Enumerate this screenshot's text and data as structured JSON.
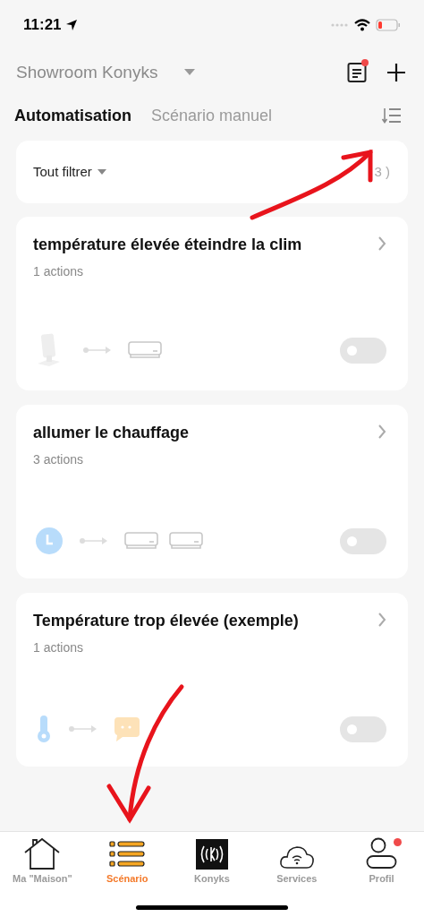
{
  "status_bar": {
    "time": "11:21"
  },
  "header": {
    "home": "Showroom Konyks",
    "notes_dot": true
  },
  "tabs": [
    {
      "label": "Automatisation",
      "selected": true
    },
    {
      "label": "Scénario manuel",
      "selected": false
    }
  ],
  "filter": {
    "label": "Tout filtrer",
    "count": "3 )"
  },
  "scenes": [
    {
      "title": "température élevée éteindre la clim",
      "subtitle": "1 actions",
      "conditions": [
        {
          "kind": "sensor"
        }
      ],
      "actions": [
        {
          "kind": "ac"
        }
      ],
      "on": false
    },
    {
      "title": "allumer le chauffage",
      "subtitle": "3 actions",
      "conditions": [
        {
          "kind": "clock"
        }
      ],
      "actions": [
        {
          "kind": "ac"
        },
        {
          "kind": "ac"
        }
      ],
      "on": false
    },
    {
      "title": "Température trop élevée (exemple)",
      "subtitle": "1 actions",
      "conditions": [
        {
          "kind": "thermometer"
        }
      ],
      "actions": [
        {
          "kind": "bubble"
        }
      ],
      "on": false
    }
  ],
  "nav": [
    {
      "label": "Ma \"Maison\"",
      "kind": "house",
      "selected": false,
      "dot": false
    },
    {
      "label": "Scénario",
      "kind": "list",
      "selected": true,
      "dot": false
    },
    {
      "label": "Konyks",
      "kind": "logo",
      "selected": false,
      "dot": false
    },
    {
      "label": "Services",
      "kind": "cloud",
      "selected": false,
      "dot": false
    },
    {
      "label": "Profil",
      "kind": "person",
      "selected": false,
      "dot": true
    }
  ]
}
